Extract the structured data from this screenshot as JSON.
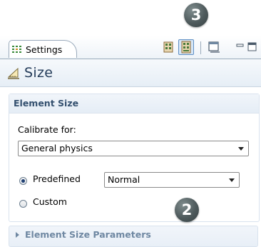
{
  "callouts": {
    "top": "3",
    "middle": "2"
  },
  "tab": {
    "label": "Settings",
    "icon": "settings-icon"
  },
  "toolbar": [
    {
      "icon": "build-mesh-icon"
    },
    {
      "icon": "build-all-icon",
      "active": true
    },
    {
      "icon": "window-restore-icon"
    },
    {
      "icon": "minimize-icon"
    },
    {
      "icon": "maximize-icon"
    }
  ],
  "header": {
    "title": "Size",
    "icon": "size-icon"
  },
  "element_size": {
    "title": "Element Size",
    "calibrate_label": "Calibrate for:",
    "calibrate_value": "General physics",
    "predefined_label": "Predefined",
    "predefined_value": "Normal",
    "custom_label": "Custom",
    "selected": "Predefined"
  },
  "parameters_section": {
    "title": "Element Size Parameters"
  },
  "colors": {
    "accent": "#5f8fc4",
    "header_text": "#243c5a",
    "section_text": "#34506f"
  }
}
